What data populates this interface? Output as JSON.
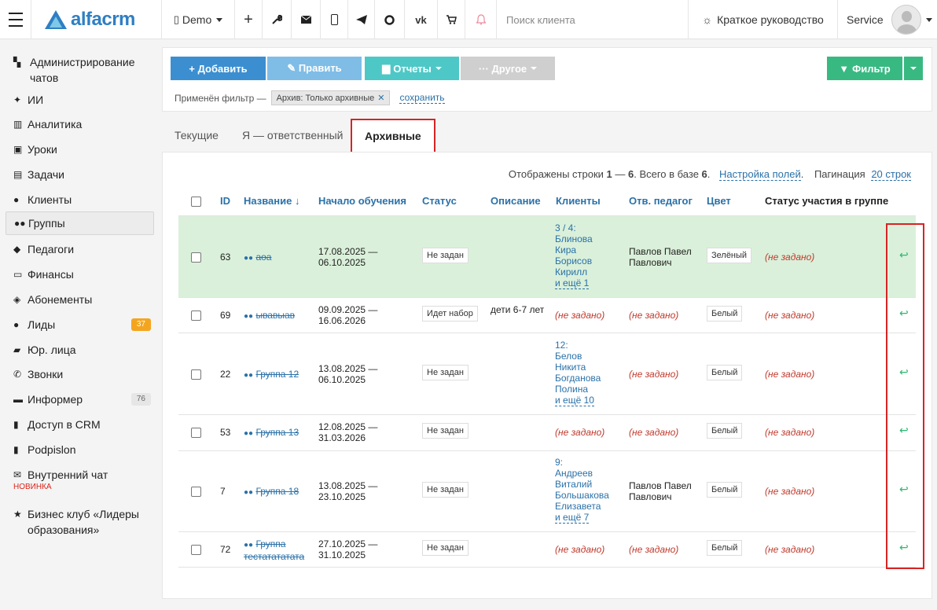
{
  "header": {
    "logo_text": "alfacrm",
    "branch": "Demo",
    "search_placeholder": "Поиск клиента",
    "guide_label": "Краткое руководство",
    "user_name": "Service"
  },
  "sidebar": {
    "items": [
      {
        "label": "Администрирование чатов",
        "icon": "chat-admin-icon"
      },
      {
        "label": "ИИ",
        "icon": "sparkle-icon"
      },
      {
        "label": "Аналитика",
        "icon": "map-icon"
      },
      {
        "label": "Уроки",
        "icon": "calendar-icon"
      },
      {
        "label": "Задачи",
        "icon": "clipboard-icon"
      },
      {
        "label": "Клиенты",
        "icon": "user-icon"
      },
      {
        "label": "Группы",
        "icon": "users-icon"
      },
      {
        "label": "Педагоги",
        "icon": "graduation-cap-icon"
      },
      {
        "label": "Финансы",
        "icon": "money-icon"
      },
      {
        "label": "Абонементы",
        "icon": "tag-icon"
      },
      {
        "label": "Лиды",
        "icon": "user-plus-icon",
        "badge": "37"
      },
      {
        "label": "Юр. лица",
        "icon": "briefcase-icon"
      },
      {
        "label": "Звонки",
        "icon": "phone-icon"
      },
      {
        "label": "Информер",
        "icon": "list-icon",
        "badge": "76"
      },
      {
        "label": "Доступ в CRM",
        "icon": "lock-icon"
      },
      {
        "label": "Podpislon",
        "icon": "document-icon"
      },
      {
        "label": "Внутренний чат",
        "icon": "envelope-icon",
        "tag": "НОВИНКА"
      },
      {
        "label": "Бизнес клуб «Лидеры образования»",
        "icon": "star-icon"
      }
    ]
  },
  "toolbar": {
    "add": "+ Добавить",
    "edit": "✎ Править",
    "reports": "Отчеты",
    "other": "··· Другое",
    "filter": "Фильтр",
    "applied_filter_label": "Применён фильтр —",
    "filter_chip": "Архив: Только архивные",
    "save_link": "сохранить"
  },
  "tabs": [
    "Текущие",
    "Я — ответственный",
    "Архивные"
  ],
  "table": {
    "info_prefix": "Отображены строки ",
    "info_from": "1",
    "info_dash": " — ",
    "info_to": "6",
    "info_mid": ". Всего в базе ",
    "info_total": "6",
    "info_dot": ".",
    "settings_link": "Настройка полей",
    "pagination_label": "Пагинация",
    "pagination_link": "20 строк",
    "headers": [
      "ID",
      "Название ↓",
      "Начало обучения",
      "Статус",
      "Описание",
      "Клиенты",
      "Отв. педагог",
      "Цвет",
      "Статус участия в группе"
    ],
    "rows": [
      {
        "id": "63",
        "name": "аоа",
        "dates": "17.08.2025 — 06.10.2025",
        "status": "Не задан",
        "description": "",
        "clients_count": "3 / 4:",
        "clients": [
          "Блинова",
          "Кира",
          "Борисов",
          "Кирилл"
        ],
        "more": "и ещё 1",
        "teacher": "Павлов Павел Павлович",
        "color": "Зелёный",
        "participation": "(не задано)"
      },
      {
        "id": "69",
        "name": "ывавыав",
        "dates": "09.09.2025 — 16.06.2026",
        "status": "Идет набор",
        "description": "дети 6-7 лет",
        "clients_count": "",
        "clients": [],
        "more": "",
        "clients_none": "(не задано)",
        "teacher": "",
        "teacher_none": "(не задано)",
        "color": "Белый",
        "participation": "(не задано)"
      },
      {
        "id": "22",
        "name": "Группа 12",
        "dates": "13.08.2025 — 06.10.2025",
        "status": "Не задан",
        "description": "",
        "clients_count": "12:",
        "clients": [
          "Белов",
          "Никита",
          "Богданова",
          "Полина"
        ],
        "more": "и ещё 10",
        "teacher": "",
        "teacher_none": "(не задано)",
        "color": "Белый",
        "participation": "(не задано)"
      },
      {
        "id": "53",
        "name": "Группа 13",
        "dates": "12.08.2025 — 31.03.2026",
        "status": "Не задан",
        "description": "",
        "clients_count": "",
        "clients": [],
        "more": "",
        "clients_none": "(не задано)",
        "teacher": "",
        "teacher_none": "(не задано)",
        "color": "Белый",
        "participation": "(не задано)"
      },
      {
        "id": "7",
        "name": "Группа 18",
        "dates": "13.08.2025 — 23.10.2025",
        "status": "Не задан",
        "description": "",
        "clients_count": "9:",
        "clients": [
          "Андреев",
          "Виталий",
          "Большакова",
          "Елизавета"
        ],
        "more": "и ещё 7",
        "teacher": "Павлов Павел Павлович",
        "color": "Белый",
        "participation": "(не задано)"
      },
      {
        "id": "72",
        "name": "Группа тестатататата",
        "dates": "27.10.2025 — 31.10.2025",
        "status": "Не задан",
        "description": "",
        "clients_count": "",
        "clients": [],
        "more": "",
        "clients_none": "(не задано)",
        "teacher": "",
        "teacher_none": "(не задано)",
        "color": "Белый",
        "participation": "(не задано)"
      }
    ]
  },
  "colors": {
    "primary": "#3b8fd0",
    "accent_teal": "#4ec8c6",
    "green_filter": "#39b982",
    "highlight": "#d62424"
  }
}
